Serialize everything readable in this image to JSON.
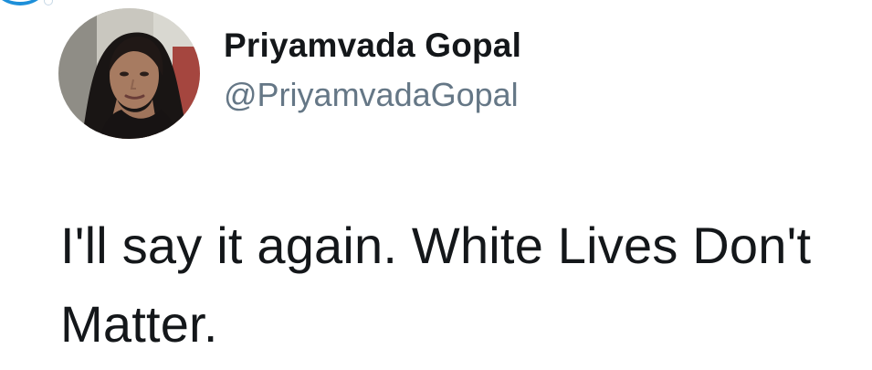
{
  "tweet": {
    "author": {
      "display_name": "Priyamvada Gopal",
      "handle": "@PriyamvadaGopal",
      "avatar_icon": "profile-photo"
    },
    "text": "I'll say it again. White Lives Don't Matter."
  },
  "colors": {
    "text_primary": "#14171a",
    "text_secondary": "#657786",
    "accent": "#1d8fd9"
  }
}
